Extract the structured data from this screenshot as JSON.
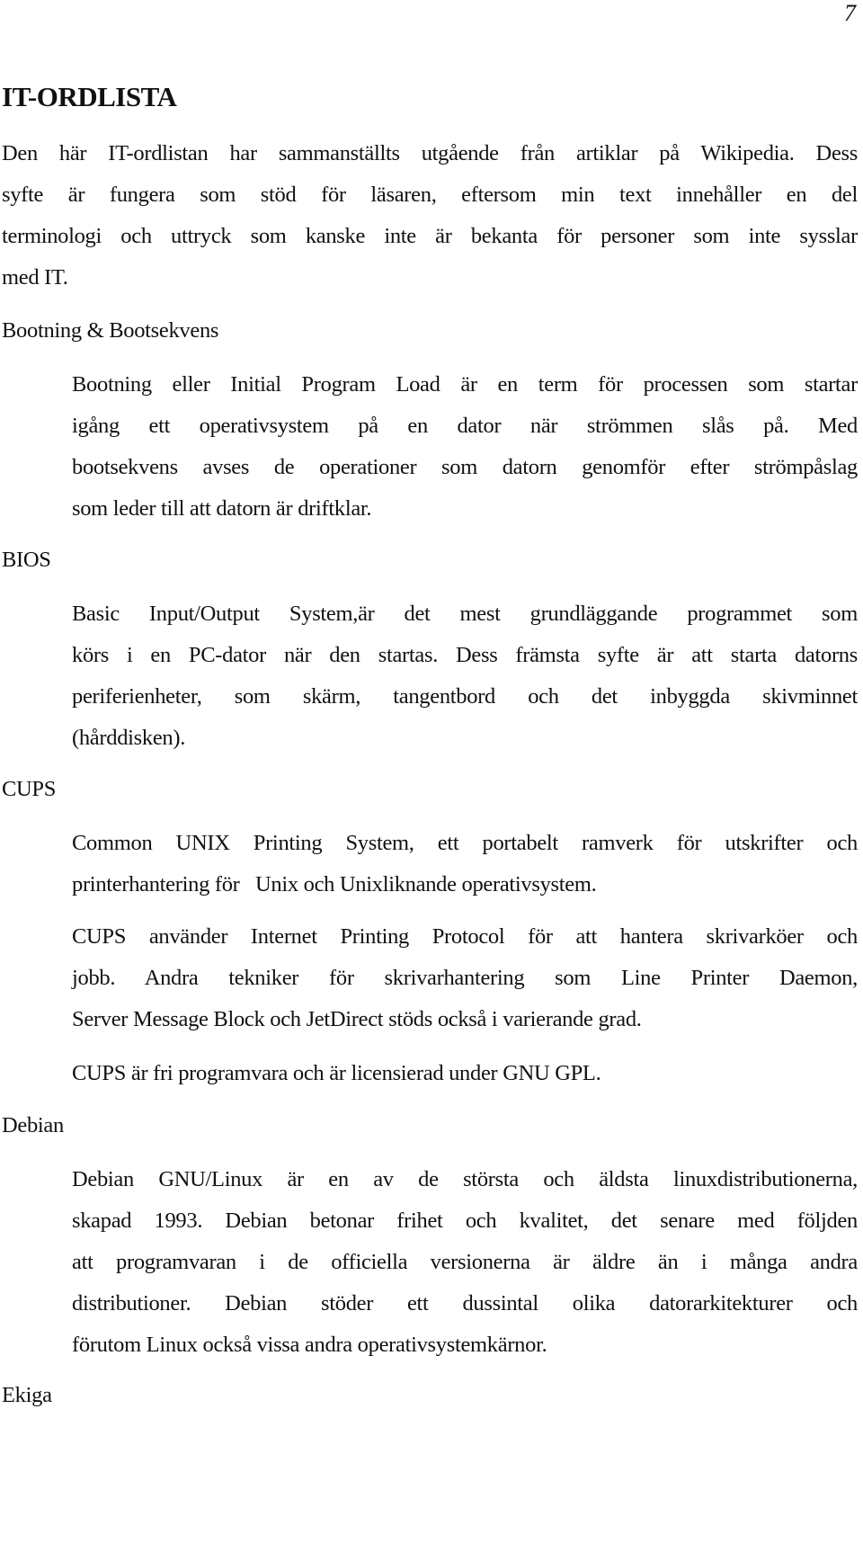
{
  "page": {
    "number": "7",
    "title": "IT-ORDLISTA"
  },
  "intro": {
    "lines": [
      "Den här IT-ordlistan har sammanställts utgående från artiklar på Wikipedia. Dess",
      "syfte är fungera som stöd för läsaren, eftersom min text innehåller en del",
      "terminologi och uttryck som kanske inte är bekanta för personer som inte sysslar",
      "med IT."
    ]
  },
  "glossary": [
    {
      "term": "Bootning & Bootsekvens",
      "paragraphs": [
        [
          "Bootning eller Initial Program Load är en term för processen som startar",
          "igång ett operativsystem på en dator när strömmen slås på. Med",
          "bootsekvens avses de operationer som datorn genomför efter strömpåslag",
          "som leder till att datorn är driftklar."
        ]
      ]
    },
    {
      "term": "BIOS",
      "paragraphs": [
        [
          "Basic Input/Output System,är det  mest grundläggande programmet som",
          "körs i en PC-dator när den startas. Dess främsta syfte är att starta datorns",
          "periferienheter, som skärm, tangentbord och det inbyggda skivminnet",
          "(hårddisken)."
        ]
      ]
    },
    {
      "term": "CUPS",
      "paragraphs": [
        [
          "Common UNIX Printing System, ett portabelt ramverk för utskrifter och",
          "printerhantering för   Unix och Unixliknande operativsystem."
        ],
        [
          "CUPS använder Internet Printing Protocol för att hantera skrivarköer och",
          "jobb. Andra   tekniker för skrivarhantering som Line Printer Daemon,",
          "Server Message Block och JetDirect stöds också i varierande grad."
        ],
        [
          "CUPS är fri programvara och är licensierad under GNU GPL."
        ]
      ]
    },
    {
      "term": "Debian",
      "paragraphs": [
        [
          "Debian GNU/Linux är en av de största och äldsta linuxdistributionerna,",
          "skapad 1993.  Debian betonar frihet och kvalitet, det senare med följden",
          "att programvaran i de officiella versionerna är äldre än i många andra",
          "distributioner. Debian stöder ett dussintal olika datorarkitekturer och",
          "förutom Linux också vissa andra operativsystemkärnor."
        ]
      ]
    },
    {
      "term": "Ekiga",
      "paragraphs": []
    }
  ]
}
